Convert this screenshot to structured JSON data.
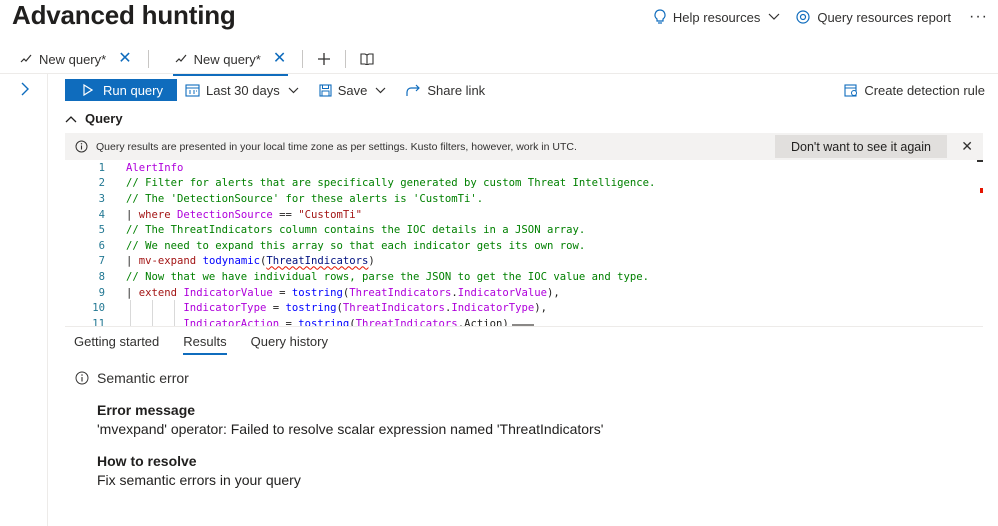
{
  "header": {
    "title": "Advanced hunting",
    "help_resources": "Help resources",
    "query_resources_report": "Query resources report",
    "more": "···"
  },
  "tabs": [
    {
      "label": "New query*",
      "active": false
    },
    {
      "label": "New query*",
      "active": true
    }
  ],
  "toolbar": {
    "run_label": "Run query",
    "time_range": "Last 30 days",
    "save_label": "Save",
    "share_label": "Share link",
    "create_rule_label": "Create detection rule"
  },
  "query_section": {
    "title": "Query"
  },
  "info_bar": {
    "message": "Query results are presented in your local time zone as per settings. Kusto filters, however, work in UTC.",
    "dismiss_label": "Don't want to see it again"
  },
  "code_lines": [
    {
      "n": "1",
      "text": "AlertInfo"
    },
    {
      "n": "2",
      "text": "// Filter for alerts that are specifically generated by custom Threat Intelligence."
    },
    {
      "n": "3",
      "text": "// The 'DetectionSource' for these alerts is 'CustomTi'."
    },
    {
      "n": "4",
      "text": "| where DetectionSource == \"CustomTi\""
    },
    {
      "n": "5",
      "text": "// The ThreatIndicators column contains the IOC details in a JSON array."
    },
    {
      "n": "6",
      "text": "// We need to expand this array so that each indicator gets its own row."
    },
    {
      "n": "7",
      "text": "| mv-expand todynamic(ThreatIndicators)"
    },
    {
      "n": "8",
      "text": "// Now that we have individual rows, parse the JSON to get the IOC value and type."
    },
    {
      "n": "9",
      "text": "| extend IndicatorValue = tostring(ThreatIndicators.IndicatorValue),"
    },
    {
      "n": "10",
      "text": "         IndicatorType = tostring(ThreatIndicators.IndicatorType),"
    },
    {
      "n": "11",
      "text": "         IndicatorAction = tostring(ThreatIndicators.Action)"
    }
  ],
  "result_tabs": [
    {
      "label": "Getting started",
      "active": false
    },
    {
      "label": "Results",
      "active": true
    },
    {
      "label": "Query history",
      "active": false
    }
  ],
  "error": {
    "heading": "Semantic error",
    "message_label": "Error message",
    "message_text": "'mvexpand' operator: Failed to resolve scalar expression named 'ThreatIndicators'",
    "resolve_label": "How to resolve",
    "resolve_text": "Fix semantic errors in your query"
  },
  "colors": {
    "accent": "#0f6cbd",
    "error_squiggle": "#e51400",
    "comment": "#008000",
    "keyword": "#af00db"
  }
}
